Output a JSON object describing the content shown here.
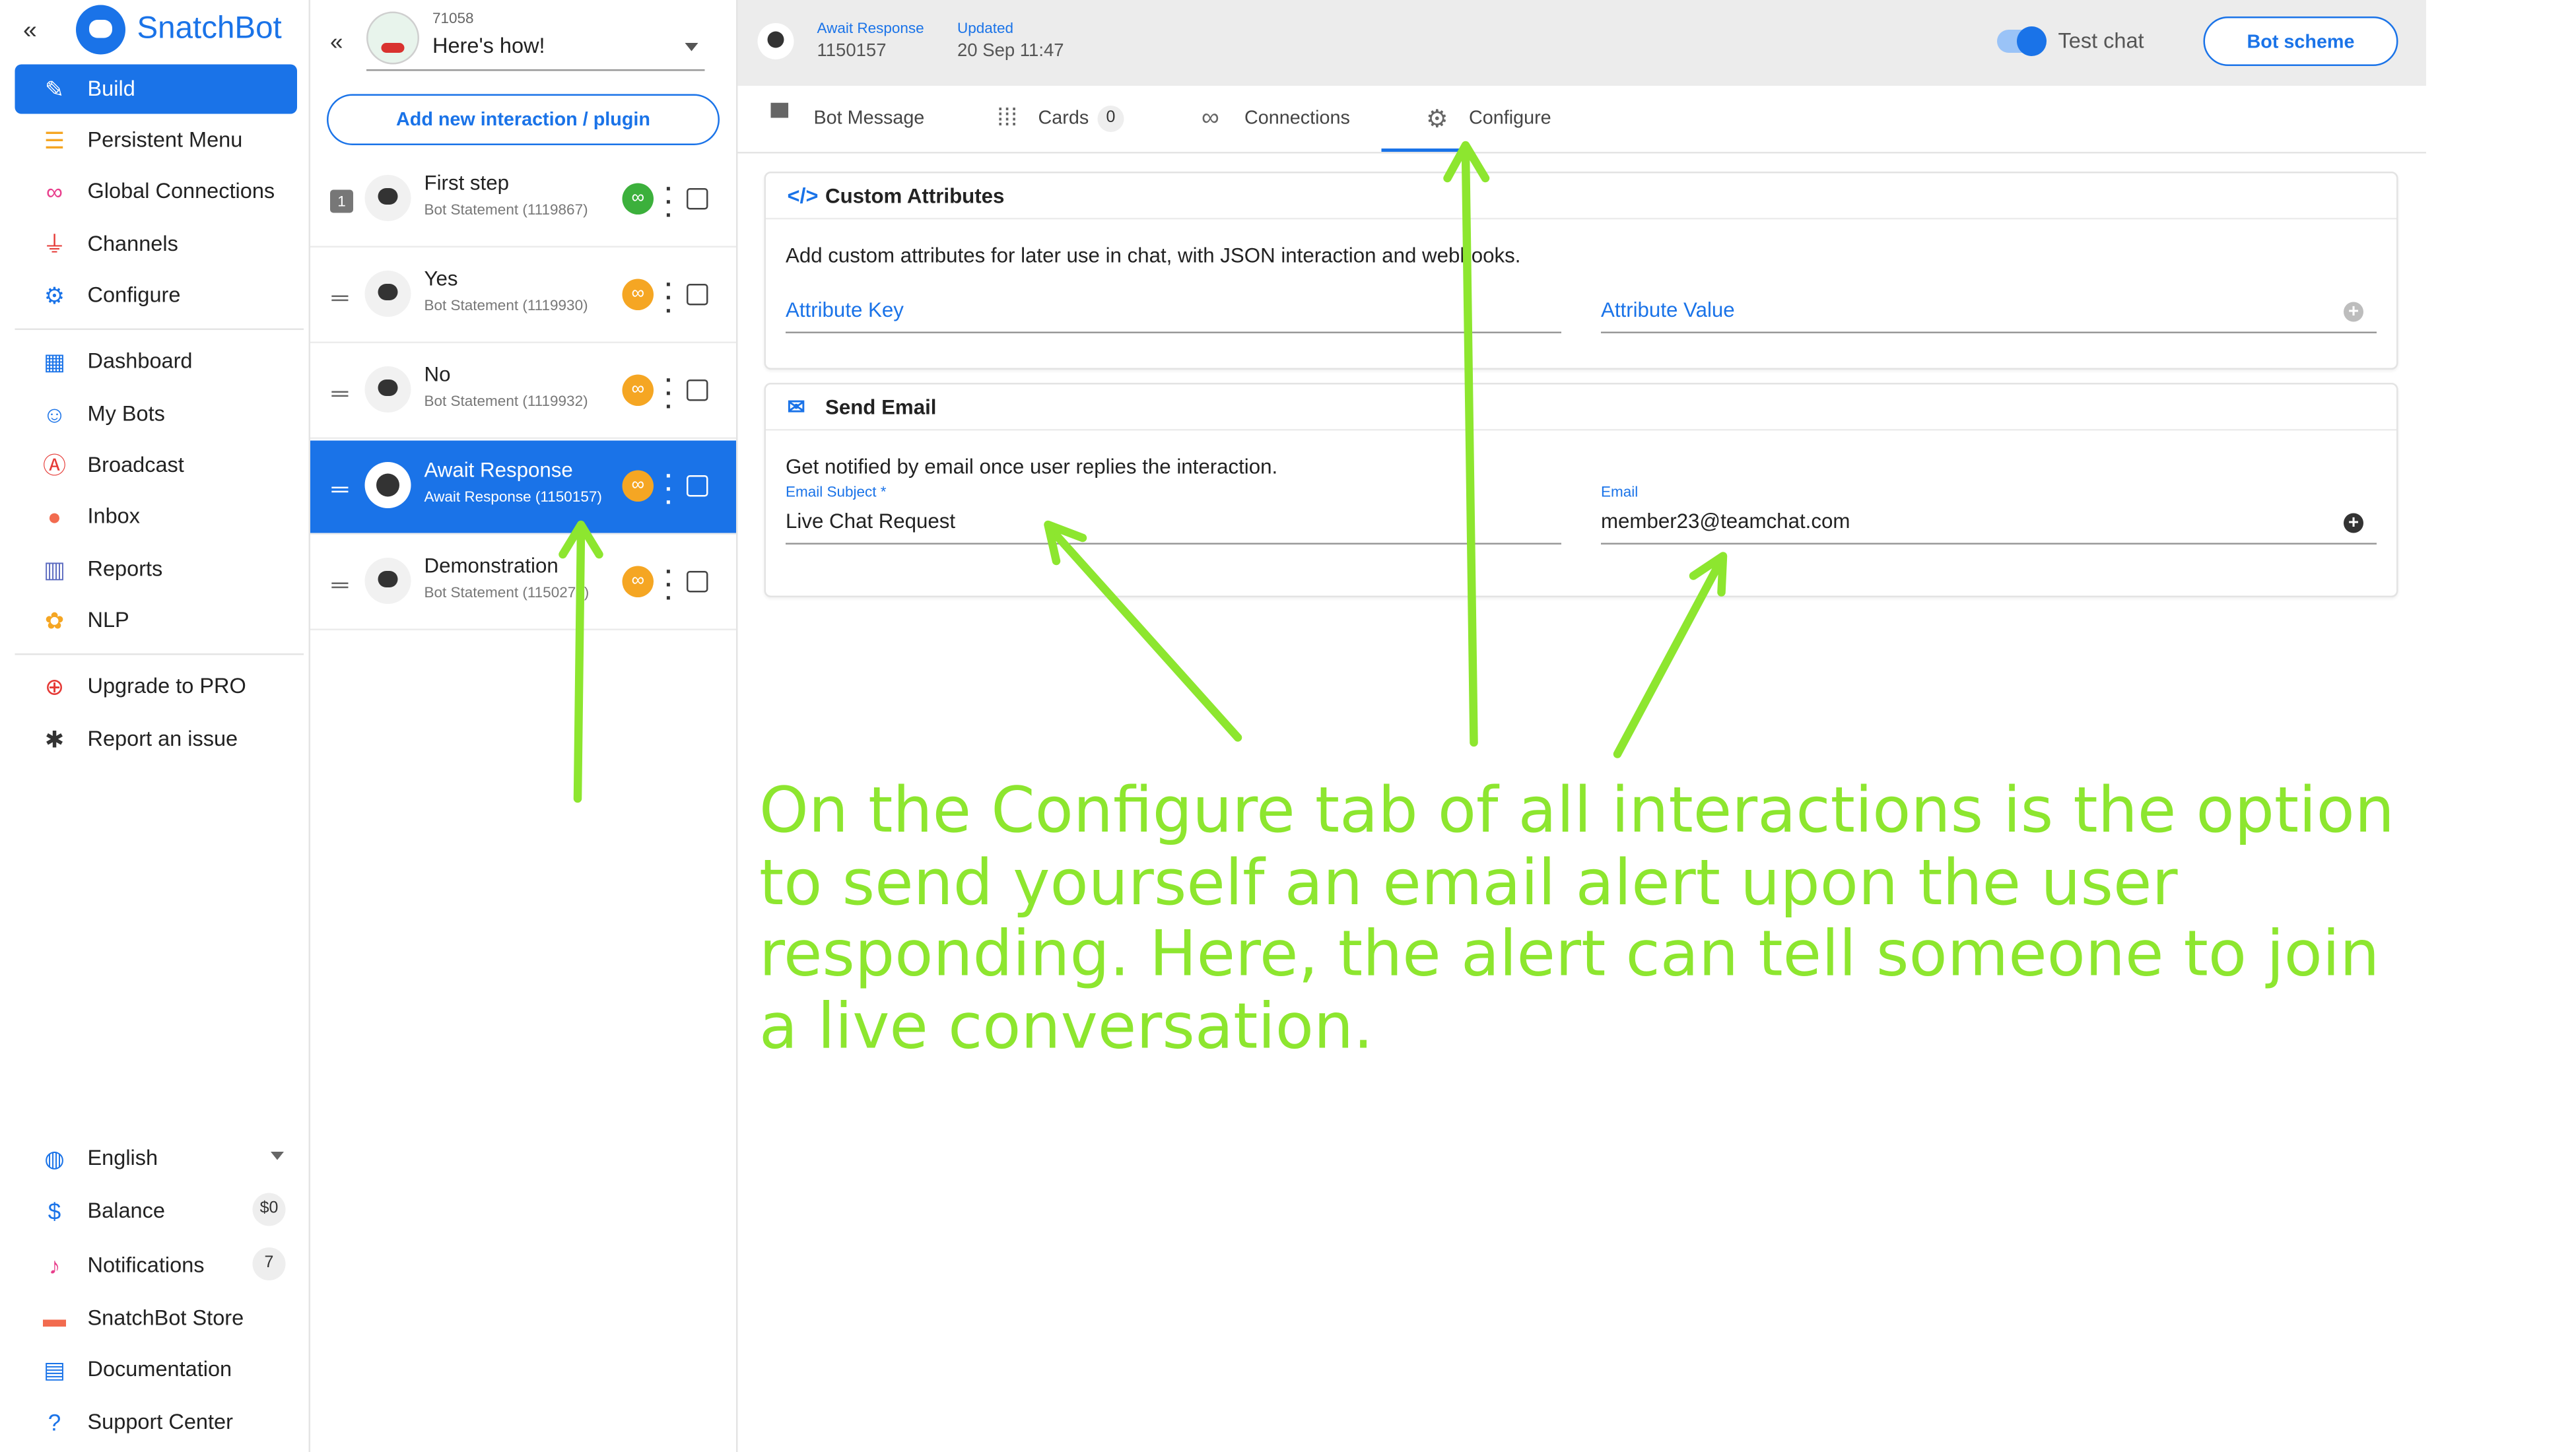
{
  "sidebar": {
    "brand": "SnatchBot",
    "items": [
      {
        "label": "Build",
        "icon": "edit-icon",
        "color": "#ffffff"
      },
      {
        "label": "Persistent Menu",
        "icon": "menu-icon",
        "color": "#f5a623"
      },
      {
        "label": "Global Connections",
        "icon": "link-icon",
        "color": "#e83e8c"
      },
      {
        "label": "Channels",
        "icon": "plug-icon",
        "color": "#e53935"
      },
      {
        "label": "Configure",
        "icon": "gear-icon",
        "color": "#1a73e8"
      },
      {
        "label": "Dashboard",
        "icon": "dashboard-icon",
        "color": "#1a73e8"
      },
      {
        "label": "My Bots",
        "icon": "robot-icon",
        "color": "#1a73e8"
      },
      {
        "label": "Broadcast",
        "icon": "broadcast-icon",
        "color": "#e53935"
      },
      {
        "label": "Inbox",
        "icon": "chat-bubbles-icon",
        "color": "#f26b4f"
      },
      {
        "label": "Reports",
        "icon": "bar-chart-icon",
        "color": "#5c6bc0"
      },
      {
        "label": "NLP",
        "icon": "nlp-icon",
        "color": "#f5a623"
      },
      {
        "label": "Upgrade to PRO",
        "icon": "plus-circle-icon",
        "color": "#e53935"
      },
      {
        "label": "Report an issue",
        "icon": "bug-icon",
        "color": "#333333"
      }
    ],
    "bottom": {
      "language": "English",
      "balance_label": "Balance",
      "balance_value": "$0",
      "notifications_label": "Notifications",
      "notifications_count": "7",
      "store": "SnatchBot Store",
      "documentation": "Documentation",
      "support": "Support Center"
    }
  },
  "bot": {
    "id": "71058",
    "name": "Here's how!",
    "add_button": "Add new interaction / plugin"
  },
  "interactions": [
    {
      "number": "1",
      "title": "First step",
      "subtitle": "Bot Statement (1119867)",
      "link_color": "green"
    },
    {
      "title": "Yes",
      "subtitle": "Bot Statement (1119930)",
      "link_color": "orange"
    },
    {
      "title": "No",
      "subtitle": "Bot Statement (1119932)",
      "link_color": "orange"
    },
    {
      "title": "Await Response",
      "subtitle": "Await Response (1150157)",
      "link_color": "orange",
      "active": true
    },
    {
      "title": "Demonstration",
      "subtitle": "Bot Statement (1150279)",
      "link_color": "orange"
    }
  ],
  "topbar": {
    "type_label": "Await Response",
    "type_value": "1150157",
    "updated_label": "Updated",
    "updated_value": "20 Sep 11:47",
    "test_chat": "Test chat",
    "bot_scheme": "Bot scheme"
  },
  "tabs": [
    {
      "label": "Bot Message",
      "icon": "message-icon"
    },
    {
      "label": "Cards",
      "icon": "grid-icon",
      "count": "0"
    },
    {
      "label": "Connections",
      "icon": "link-icon"
    },
    {
      "label": "Configure",
      "icon": "gear-icon",
      "active": true
    }
  ],
  "custom_attributes": {
    "title": "Custom Attributes",
    "description": "Add custom attributes for later use in chat, with JSON interaction and webhooks.",
    "key_placeholder": "Attribute Key",
    "value_placeholder": "Attribute Value"
  },
  "send_email": {
    "title": "Send Email",
    "description": "Get notified by email once user replies the interaction.",
    "subject_label": "Email Subject *",
    "subject_value": "Live Chat Request",
    "email_label": "Email",
    "email_value": "member23@teamchat.com"
  },
  "annotation": {
    "text": "On the Configure tab of all interactions is the option to send yourself an email alert upon the user responding. Here, the alert can tell someone to join a live conversation.",
    "color": "#8de62f"
  },
  "colors": {
    "accent": "#1a73e8",
    "annotation": "#8de62f"
  }
}
